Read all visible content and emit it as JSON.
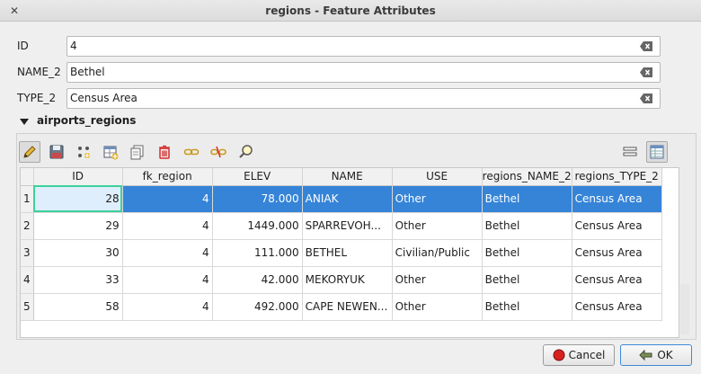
{
  "window": {
    "title": "regions - Feature Attributes"
  },
  "fields": [
    {
      "label": "ID",
      "value": "4"
    },
    {
      "label": "NAME_2",
      "value": "Bethel"
    },
    {
      "label": "TYPE_2",
      "value": "Census Area"
    }
  ],
  "relation": {
    "title": "airports_regions"
  },
  "toolbar": {
    "icons": [
      "pencil-icon",
      "save-icon",
      "add-feature-icon",
      "add-table-icon",
      "duplicate-icon",
      "delete-icon",
      "link-icon",
      "unlink-icon",
      "zoom-icon"
    ],
    "view_icons": [
      "form-view-icon",
      "table-view-icon"
    ]
  },
  "table": {
    "columns": [
      "ID",
      "fk_region",
      "ELEV",
      "NAME",
      "USE",
      "regions_NAME_2",
      "regions_TYPE_2"
    ],
    "rows": [
      {
        "num": "1",
        "cells": [
          "28",
          "4",
          "78.000",
          "ANIAK",
          "Other",
          "Bethel",
          "Census Area"
        ]
      },
      {
        "num": "2",
        "cells": [
          "29",
          "4",
          "1449.000",
          "SPARREVOH...",
          "Other",
          "Bethel",
          "Census Area"
        ]
      },
      {
        "num": "3",
        "cells": [
          "30",
          "4",
          "111.000",
          "BETHEL",
          "Civilian/Public",
          "Bethel",
          "Census Area"
        ]
      },
      {
        "num": "4",
        "cells": [
          "33",
          "4",
          "42.000",
          "MEKORYUK",
          "Other",
          "Bethel",
          "Census Area"
        ]
      },
      {
        "num": "5",
        "cells": [
          "58",
          "4",
          "492.000",
          "CAPE NEWEN...",
          "Other",
          "Bethel",
          "Census Area"
        ]
      }
    ],
    "selected_row": 0
  },
  "buttons": {
    "cancel": "Cancel",
    "ok": "OK"
  },
  "colors": {
    "selection": "#3584d8",
    "current_cell_border": "#3dd19a",
    "delete": "#d62b2b"
  }
}
